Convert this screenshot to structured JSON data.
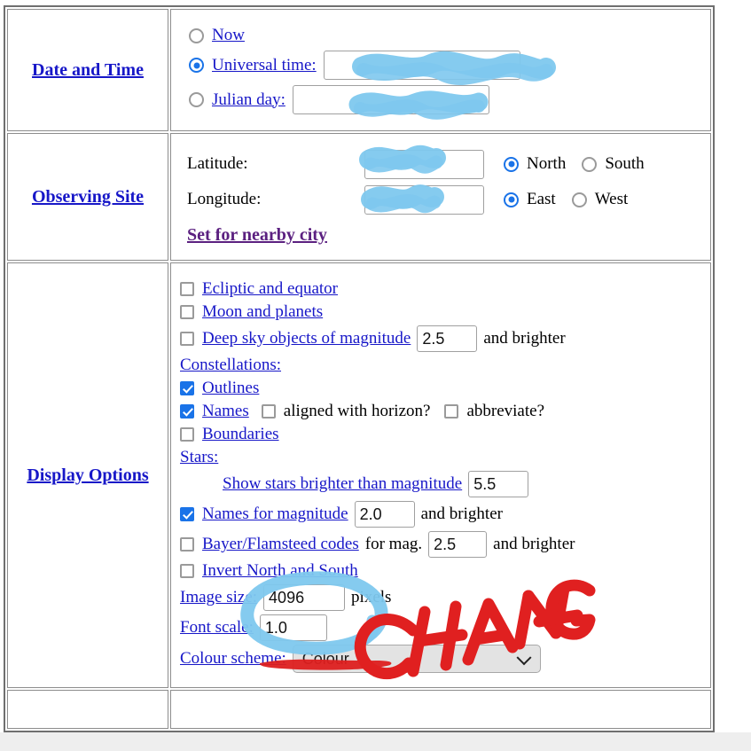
{
  "sections": [
    {
      "label": "Date and Time",
      "options": [
        {
          "label": "Now",
          "selected": false,
          "has_input": false,
          "value": ""
        },
        {
          "label": "Universal time:",
          "selected": true,
          "has_input": true,
          "value": "",
          "redacted": true
        },
        {
          "label": "Julian day:",
          "selected": false,
          "has_input": true,
          "value": "",
          "redacted": true
        }
      ]
    },
    {
      "label": "Observing Site",
      "latitude_label": "Latitude:",
      "latitude_value": "",
      "latitude_redacted": true,
      "longitude_label": "Longitude:",
      "longitude_value": "",
      "longitude_redacted": true,
      "north_label": "North",
      "south_label": "South",
      "east_label": "East",
      "west_label": "West",
      "north_selected": true,
      "south_selected": false,
      "east_selected": true,
      "west_selected": false,
      "nearby_city_link": "Set for nearby city"
    }
  ],
  "display_options": {
    "label": "Display Options",
    "ecliptic_and_equator": {
      "label": "Ecliptic and equator",
      "checked": false
    },
    "moon_and_planets": {
      "label": "Moon and planets",
      "checked": false
    },
    "deep_sky": {
      "label": "Deep sky objects of magnitude",
      "checked": false,
      "value": "2.5",
      "suffix": "and brighter"
    },
    "constellations_label": "Constellations:",
    "outlines": {
      "label": "Outlines",
      "checked": true
    },
    "names": {
      "label": "Names",
      "checked": true
    },
    "aligned_with_horizon": {
      "label": "aligned with horizon?",
      "checked": false
    },
    "abbreviate": {
      "label": "abbreviate?",
      "checked": false
    },
    "boundaries": {
      "label": "Boundaries",
      "checked": false
    },
    "stars_label": "Stars:",
    "show_stars": {
      "label": "Show stars brighter than magnitude",
      "value": "5.5"
    },
    "names_for_magnitude": {
      "label": "Names for magnitude",
      "checked": true,
      "value": "2.0",
      "suffix": "and brighter"
    },
    "bayer_flamsteed": {
      "label": "Bayer/Flamsteed codes",
      "checked": false,
      "mid": "for mag.",
      "value": "2.5",
      "suffix": "and brighter"
    },
    "invert_north_south": {
      "label": "Invert North and South",
      "checked": false
    },
    "image_size": {
      "label": "Image size:",
      "value": "4096",
      "suffix": "pixels"
    },
    "font_scale": {
      "label": "Font scale:",
      "value": "1.0"
    },
    "colour_scheme": {
      "label": "Colour scheme:",
      "value": "Colour"
    }
  },
  "annotations": {
    "circle_target": "4096",
    "circle_colour": "#7ec8ee",
    "underline_colour": "#dd1f1f",
    "change_text": "CHANGE",
    "change_colour": "#e02020"
  }
}
